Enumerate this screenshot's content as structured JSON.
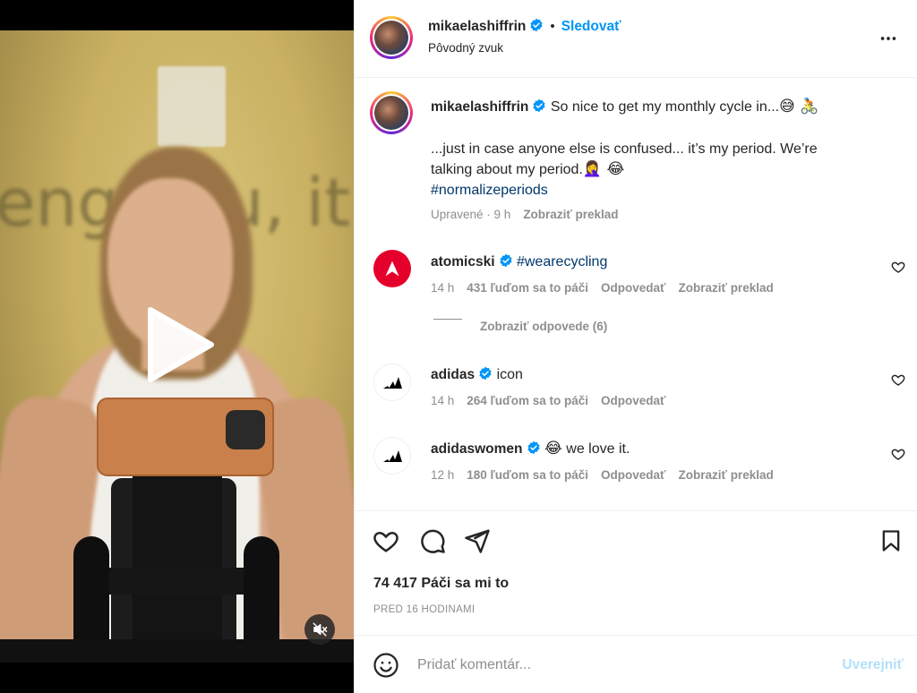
{
  "video": {
    "mute_icon": "speaker-muted-icon",
    "play_icon": "play-icon"
  },
  "post": {
    "author": "mikaelashiffrin",
    "follow_label": "Sledovať",
    "separator": "•",
    "audio_label": "Pôvodný zvuk",
    "more_icon": "three-dots-icon",
    "caption": {
      "author": "mikaelashiffrin",
      "line1": "So nice to get my monthly cycle in...",
      "line1_emojis": "😅 🚴",
      "line2": "...just in case anyone else is confused... it’s my period. We’re",
      "line3": "talking about my period.",
      "line3_emojis": "🤦‍♀️ 😂",
      "hashtag": "#normalizeperiods",
      "edited": "Upravené · 9 h",
      "translate": "Zobraziť preklad"
    },
    "comments": [
      {
        "author": "atomicski",
        "text": "#wearecycling",
        "time": "14 h",
        "likes": "431 ľuďom sa to páči",
        "reply": "Odpovedať",
        "translate": "Zobraziť preklad",
        "view_replies": "Zobraziť odpovede (6)"
      },
      {
        "author": "adidas",
        "text": "icon",
        "time": "14 h",
        "likes": "264 ľuďom sa to páči",
        "reply": "Odpovedať"
      },
      {
        "author": "adidaswomen",
        "emoji": "😂",
        "text": "we love it.",
        "time": "12 h",
        "likes": "180 ľuďom sa to páči",
        "reply": "Odpovedať",
        "translate": "Zobraziť preklad"
      }
    ],
    "like_count": "74 417 Páči sa mi to",
    "posted_ago": "PRED 16 HODINAMI",
    "composer": {
      "placeholder": "Pridať komentár...",
      "post_label": "Uverejniť"
    }
  },
  "colors": {
    "accent": "#0095f6",
    "muted": "#8e8e8e",
    "hashtag": "#00376b",
    "post_disabled": "#b2dffc",
    "atomic_red": "#e4002b"
  }
}
